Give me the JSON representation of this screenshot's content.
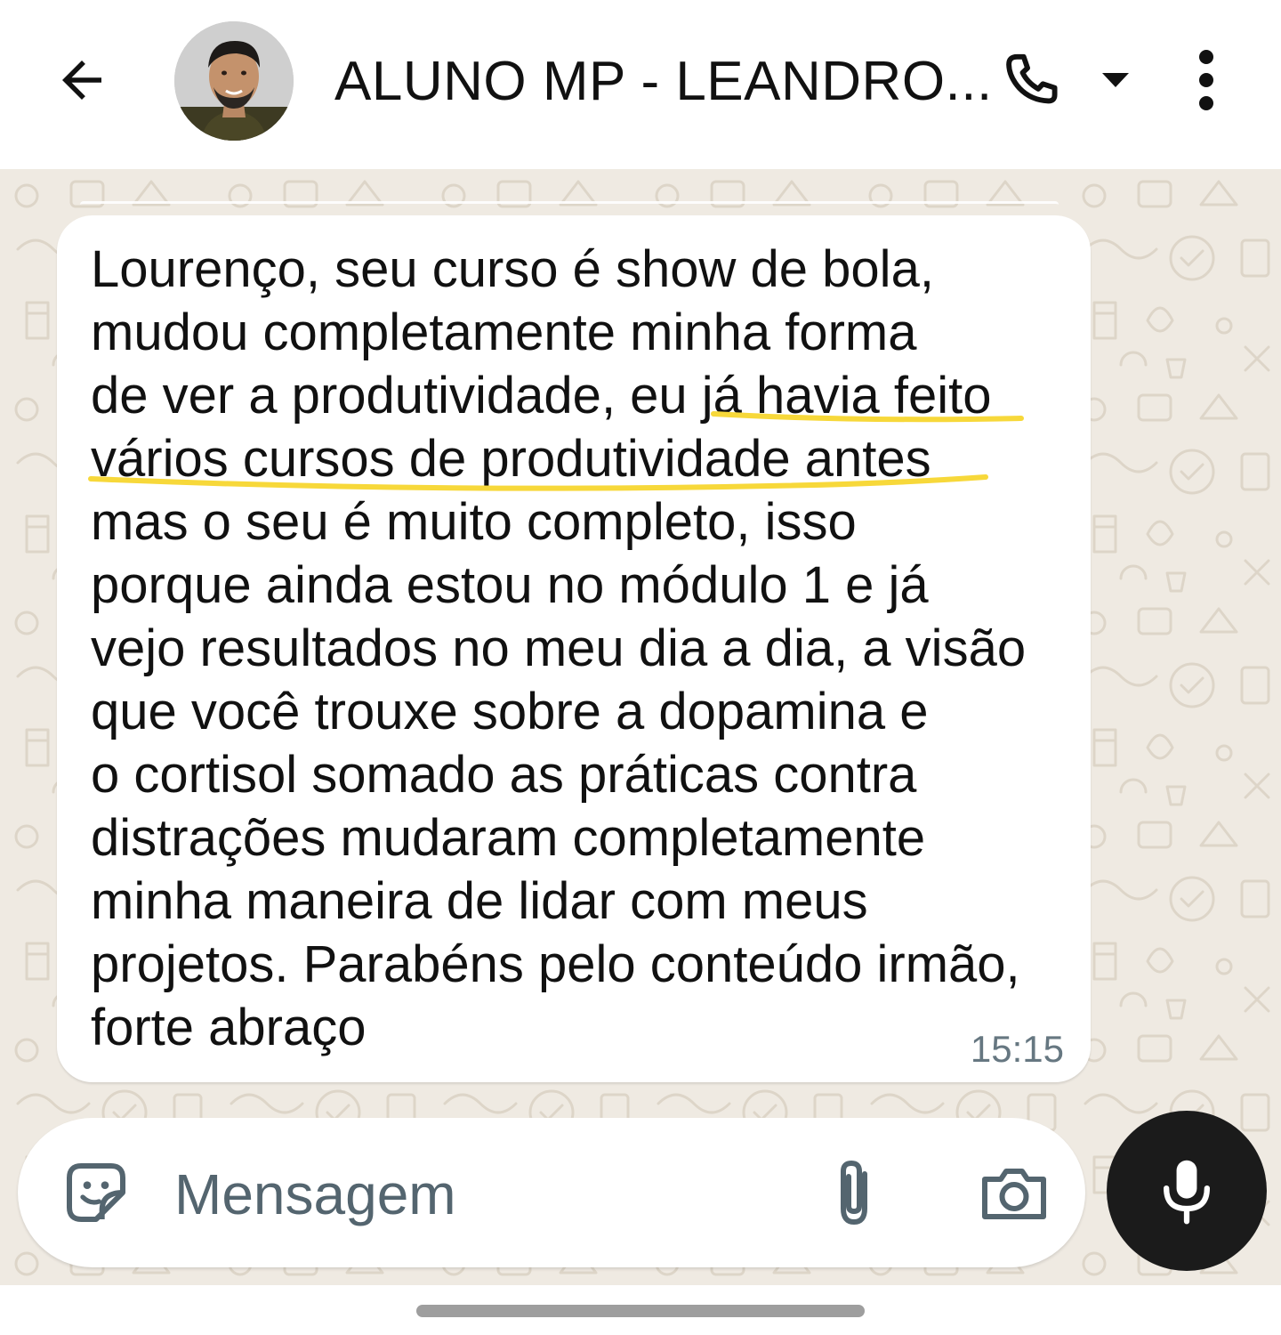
{
  "header": {
    "contact_name": "ALUNO MP - LEANDRO..."
  },
  "message": {
    "lines": [
      "Lourenço, seu curso é show de bola,",
      "mudou completamente minha forma",
      "de ver a produtividade, eu já havia feito",
      "vários cursos de produtividade antes",
      "mas o seu é muito completo, isso",
      "porque ainda estou no módulo 1 e já",
      "vejo resultados no meu dia a dia, a visão",
      "que você trouxe sobre a dopamina e",
      "o cortisol somado as práticas contra",
      "distrações mudaram completamente",
      "minha maneira de lidar com meus",
      "projetos. Parabéns pelo conteúdo irmão,",
      "forte abraço"
    ],
    "time": "15:15",
    "highlight_color": "#f7d83a"
  },
  "composer": {
    "placeholder": "Mensagem",
    "value": ""
  },
  "icons": {
    "back": "arrow-left-icon",
    "call": "phone-icon",
    "call_caret": "caret-down-icon",
    "menu": "more-vertical-icon",
    "emoji": "sticker-emoji-icon",
    "attach": "paperclip-icon",
    "camera": "camera-icon",
    "mic": "microphone-icon"
  },
  "colors": {
    "wallpaper": "#efeae2",
    "bubble": "#ffffff",
    "text": "#111111",
    "timestamp": "#667781",
    "mic_button": "#1b1b1b"
  }
}
